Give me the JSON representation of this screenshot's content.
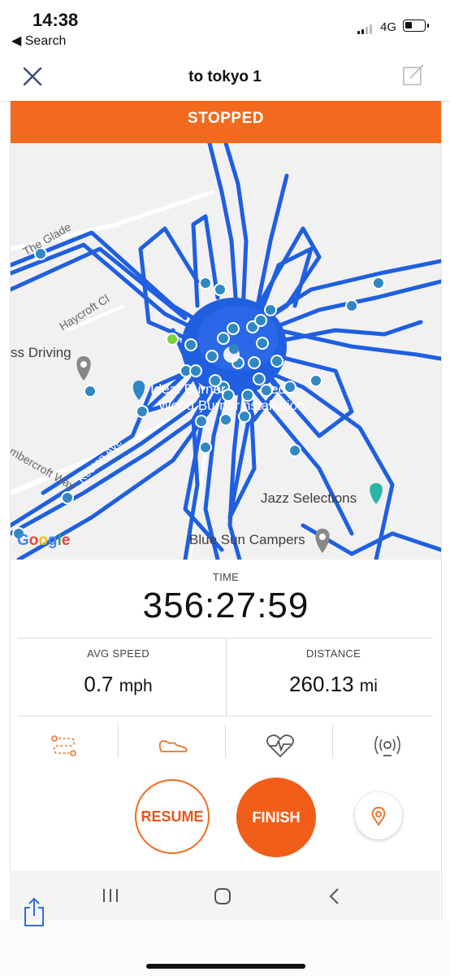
{
  "status": {
    "time": "14:38",
    "back_label": "◀ Search",
    "network": "4G"
  },
  "nav": {
    "title": "to tokyo 1",
    "close_icon": "close-icon",
    "edit_icon": "edit-icon"
  },
  "banner": {
    "text": "STOPPED",
    "color": "#f26a1d"
  },
  "map": {
    "labels": [
      "The Glade",
      "Haycroft Cl",
      "Keston Ave",
      "mbercroft Way"
    ],
    "pois": [
      "ss Driving",
      "Ideal Burner",
      "ed",
      "Wood Burner",
      "nstallation",
      "Jazz Selections",
      "Blue Sun Campers"
    ],
    "attribution": "Google",
    "route_color": "#1f5fe0"
  },
  "stats": {
    "time_label": "TIME",
    "time_value": "356:27:59",
    "avg_speed_label": "AVG SPEED",
    "avg_speed_value": "0.7",
    "avg_speed_unit": "mph",
    "distance_label": "DISTANCE",
    "distance_value": "260.13",
    "distance_unit": "mi"
  },
  "tabs": [
    "route-icon",
    "shoe-icon",
    "heart-rate-icon",
    "sensor-icon"
  ],
  "actions": {
    "resume": "RESUME",
    "finish": "FINISH",
    "location_icon": "location-pin-icon"
  },
  "accent_color": "#f26a1d"
}
